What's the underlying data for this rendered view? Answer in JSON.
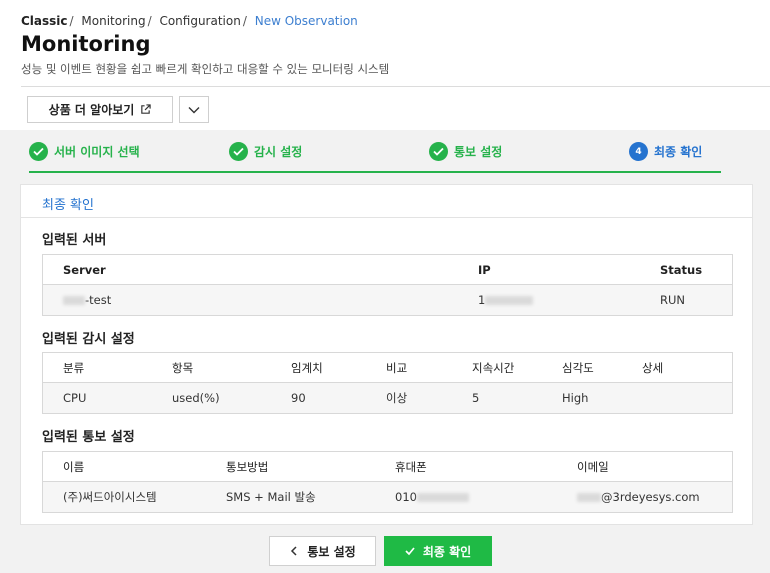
{
  "breadcrumb": {
    "items": [
      "Classic",
      "Monitoring",
      "Configuration"
    ],
    "current": "New Observation",
    "separator": "/"
  },
  "header": {
    "title": "Monitoring",
    "subtitle": "성능 및 이벤트 현황을 쉽고 빠르게 확인하고 대응할 수 있는 모니터링 시스템"
  },
  "actions": {
    "learn_more_label": "상품 더 알아보기",
    "learn_more_icon": "external-link-icon",
    "dropdown_icon": "chevron-down-icon"
  },
  "steps": [
    {
      "label": "서버 이미지 선택",
      "status": "done"
    },
    {
      "label": "감시 설정",
      "status": "done"
    },
    {
      "label": "통보 설정",
      "status": "done"
    },
    {
      "label": "최종 확인",
      "status": "current",
      "number": "4"
    }
  ],
  "card": {
    "title": "최종 확인"
  },
  "server_section": {
    "title": "입력된 서버",
    "columns": [
      "Server",
      "IP",
      "Status"
    ],
    "rows": [
      {
        "server": "-test",
        "ip": "1",
        "status": "RUN"
      }
    ]
  },
  "monitor_section": {
    "title": "입력된 감시 설정",
    "columns": [
      "분류",
      "항목",
      "임계치",
      "비교",
      "지속시간",
      "심각도",
      "상세"
    ],
    "rows": [
      {
        "category": "CPU",
        "item": "used(%)",
        "threshold": "90",
        "compare": "이상",
        "duration": "5",
        "severity": "High",
        "detail": ""
      }
    ]
  },
  "notify_section": {
    "title": "입력된 통보 설정",
    "columns": [
      "이름",
      "통보방법",
      "휴대폰",
      "이메일"
    ],
    "rows": [
      {
        "name": "(주)써드아이시스템",
        "method": "SMS + Mail 발송",
        "phone": "010",
        "email": "@3rdeyesys.com"
      }
    ]
  },
  "footer": {
    "back_label": "통보 설정",
    "confirm_label": "최종 확인"
  },
  "colors": {
    "accent_green": "#26b24b",
    "accent_blue": "#2573cf",
    "confirm_button": "#1fba45"
  }
}
